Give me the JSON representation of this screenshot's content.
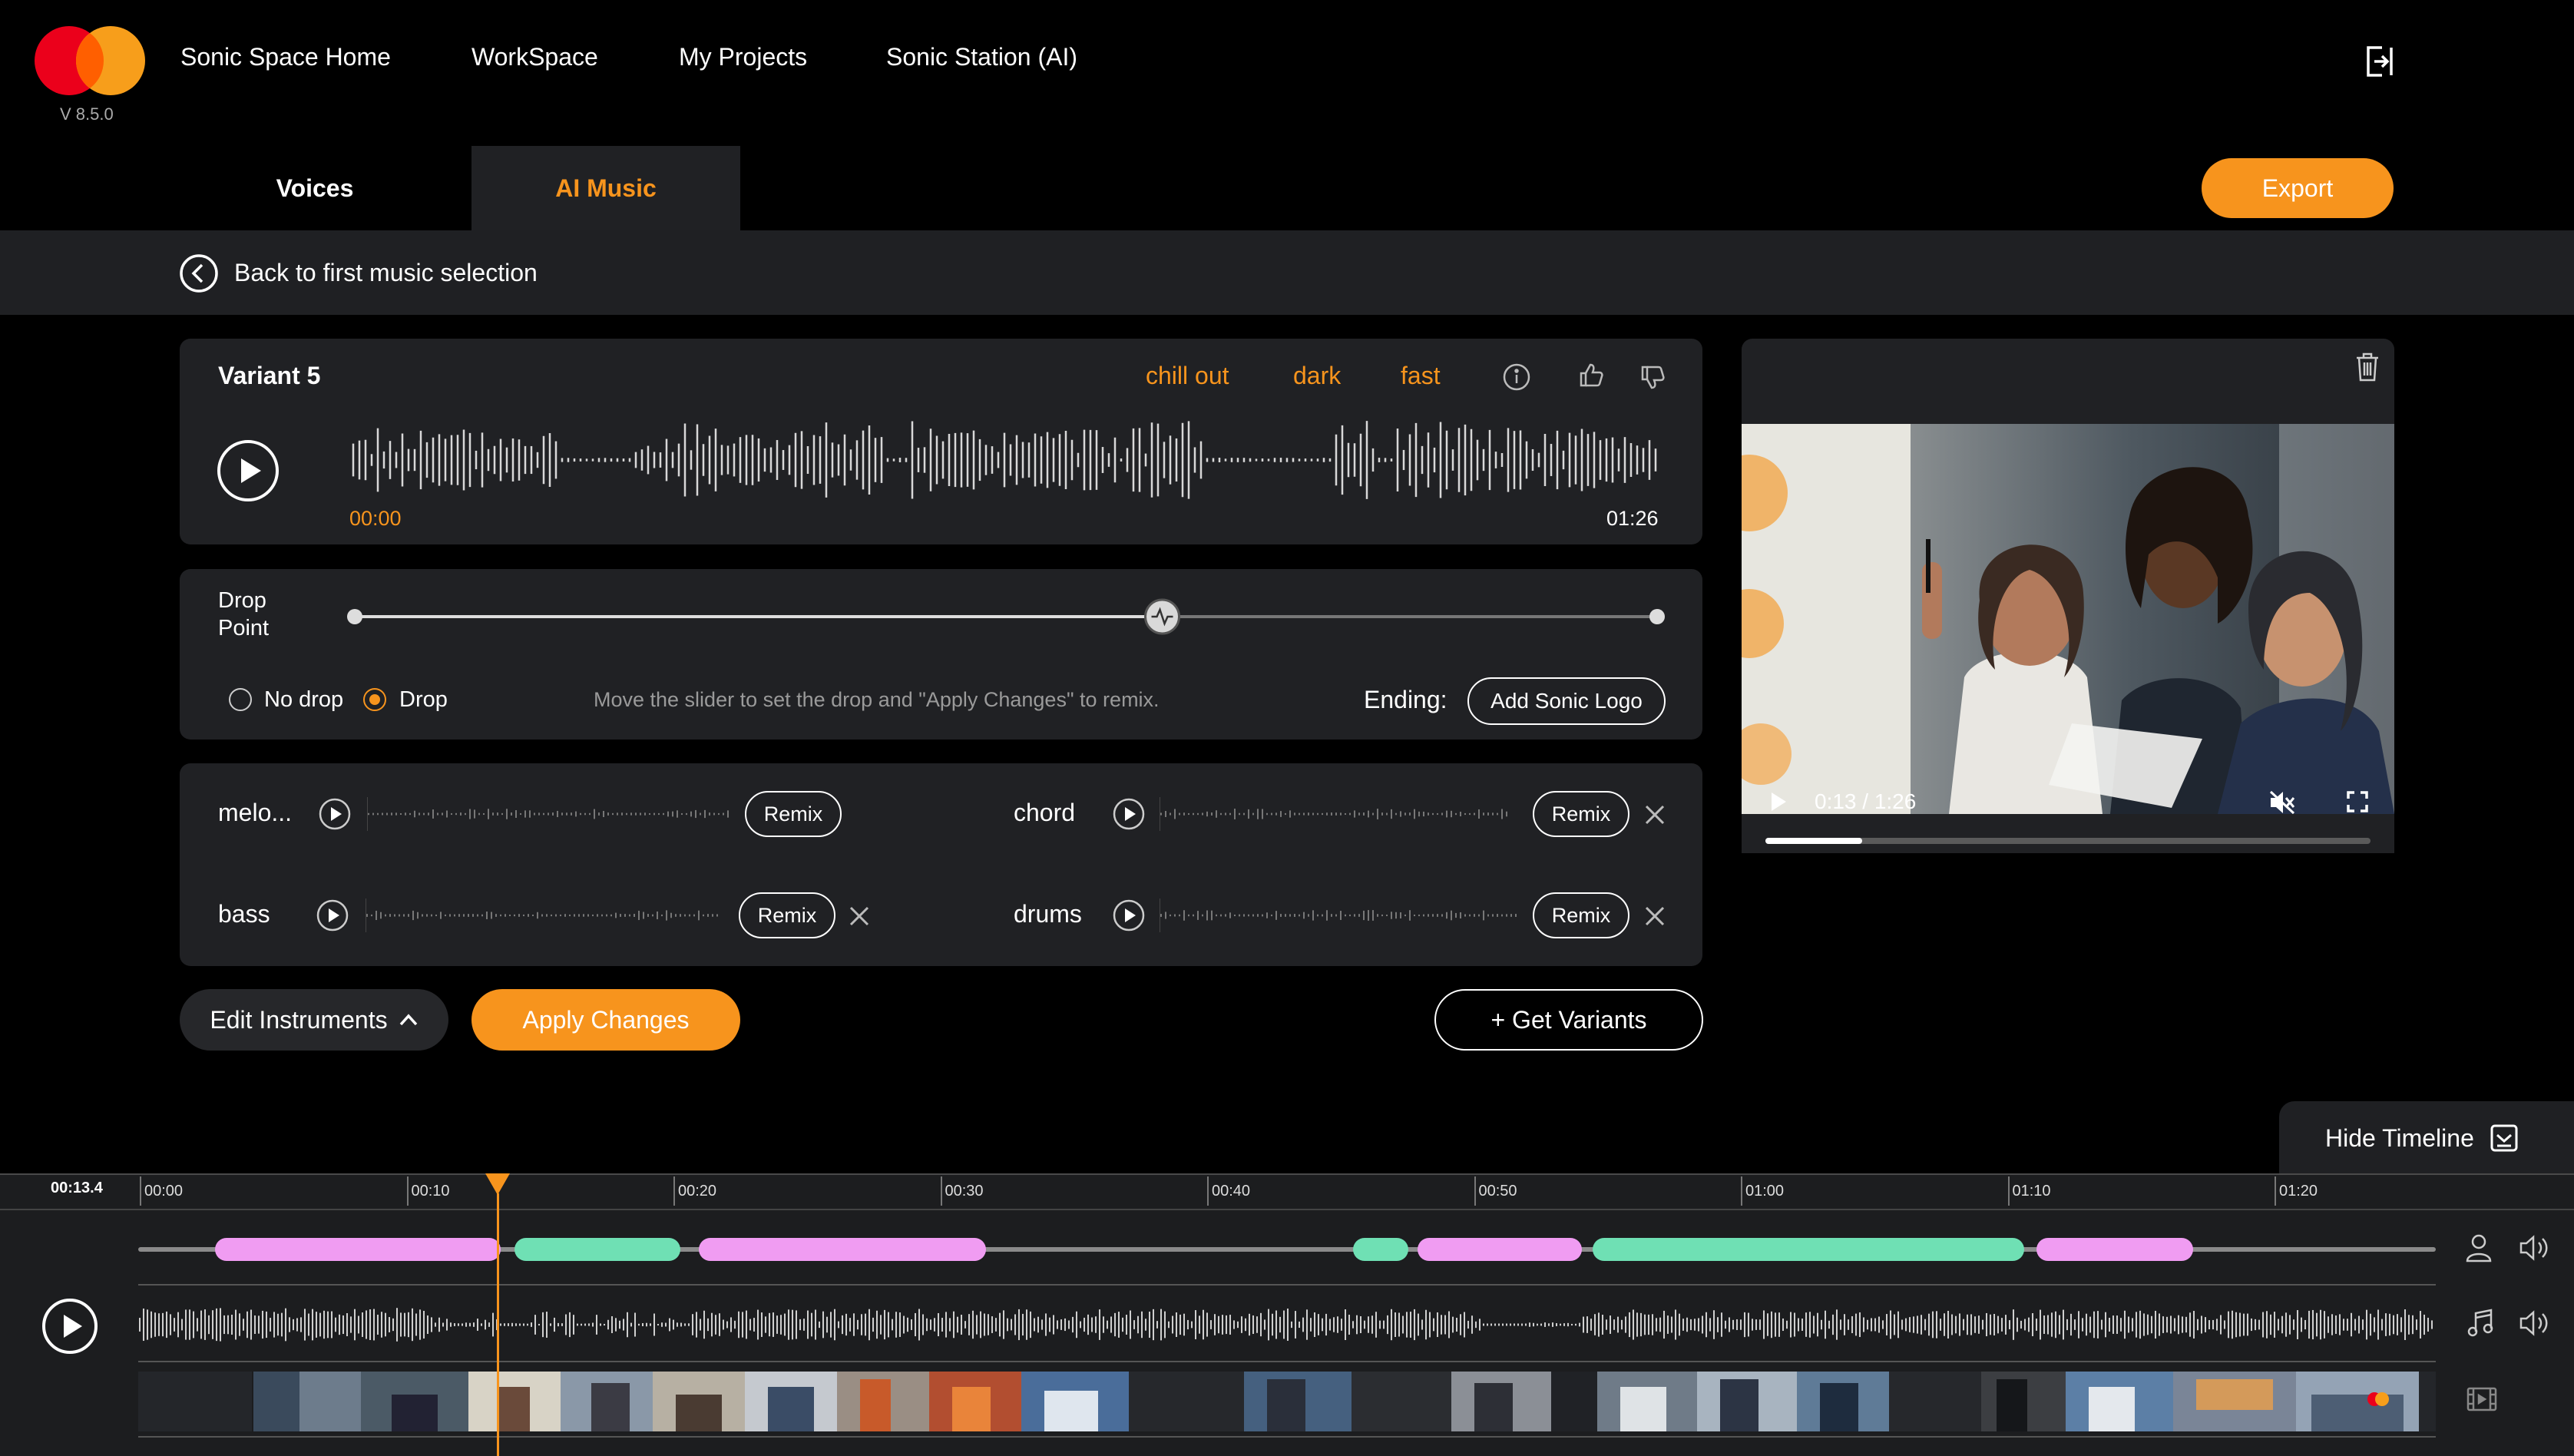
{
  "app": {
    "version": "V 8.5.0",
    "accent": "#f7941d",
    "logo": "mastercard-logo"
  },
  "nav": {
    "items": [
      {
        "label": "Sonic Space Home",
        "active": false
      },
      {
        "label": "WorkSpace",
        "active": true
      },
      {
        "label": "My Projects",
        "active": false
      },
      {
        "label": "Sonic Station (AI)",
        "active": false
      }
    ],
    "logout_icon": "logout-icon"
  },
  "tabs": {
    "voices": "Voices",
    "ai_music": "AI Music",
    "active": "AI Music"
  },
  "export_label": "Export",
  "back_label": "Back to first music selection",
  "variant": {
    "title": "Variant 5",
    "tags": [
      "chill out",
      "dark",
      "fast"
    ],
    "time_current": "00:00",
    "time_total": "01:26"
  },
  "drop": {
    "label_line1": "Drop",
    "label_line2": "Point",
    "slider_value": 0.62,
    "option_no_drop": "No drop",
    "option_drop": "Drop",
    "selected": "Drop",
    "hint": "Move the slider to set the drop and \"Apply Changes\" to remix.",
    "ending_label": "Ending:",
    "ending_button": "Add Sonic Logo"
  },
  "stems": [
    {
      "name": "melo...",
      "remix": "Remix",
      "removable": false
    },
    {
      "name": "chord",
      "remix": "Remix",
      "removable": true
    },
    {
      "name": "bass",
      "remix": "Remix",
      "removable": true
    },
    {
      "name": "drums",
      "remix": "Remix",
      "removable": true
    }
  ],
  "actions": {
    "edit_instruments": "Edit Instruments",
    "apply_changes": "Apply Changes",
    "get_variants": "+ Get Variants"
  },
  "video": {
    "time_display": "0:13 / 1:26",
    "progress": 0.16
  },
  "timeline": {
    "hide_label": "Hide Timeline",
    "current_time": "00:13.4",
    "ticks": [
      "00:00",
      "00:10",
      "00:20",
      "00:30",
      "00:40",
      "00:50",
      "01:00",
      "01:10",
      "01:20"
    ],
    "playhead_seconds": 13.4
  },
  "colors": {
    "pink": "#f09cf2",
    "teal": "#6fe0b4",
    "panel": "#202124",
    "subbar": "#1f2023"
  }
}
